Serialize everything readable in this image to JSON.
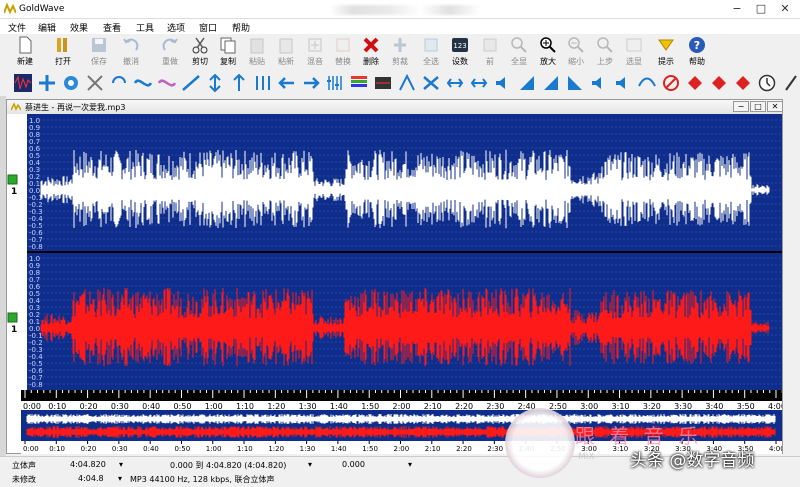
{
  "window": {
    "title": "GoldWave",
    "controls": [
      "−",
      "□",
      "✕"
    ]
  },
  "menu": [
    "文件",
    "编辑",
    "效果",
    "查看",
    "工具",
    "选项",
    "窗口",
    "帮助"
  ],
  "toolbar": [
    {
      "label": "新建",
      "icon": "new-file-icon",
      "enabled": true
    },
    {
      "label": "打开",
      "icon": "open-folder-icon",
      "enabled": true
    },
    {
      "label": "保存",
      "icon": "save-icon",
      "enabled": false
    },
    {
      "label": "撤消",
      "icon": "undo-icon",
      "enabled": false
    },
    {
      "label": "重做",
      "icon": "redo-icon",
      "enabled": false
    },
    {
      "label": "剪切",
      "icon": "scissors-icon",
      "enabled": true
    },
    {
      "label": "复制",
      "icon": "copy-icon",
      "enabled": true
    },
    {
      "label": "粘贴",
      "icon": "paste-icon",
      "enabled": false
    },
    {
      "label": "粘新",
      "icon": "paste-new-icon",
      "enabled": false
    },
    {
      "label": "混音",
      "icon": "mix-icon",
      "enabled": false
    },
    {
      "label": "替换",
      "icon": "replace-icon",
      "enabled": false
    },
    {
      "label": "删除",
      "icon": "delete-icon",
      "enabled": true
    },
    {
      "label": "剪裁",
      "icon": "trim-icon",
      "enabled": false
    },
    {
      "label": "全选",
      "icon": "select-all-icon",
      "enabled": false
    },
    {
      "label": "设数",
      "icon": "set-marker-icon",
      "enabled": true
    },
    {
      "label": "前",
      "icon": "previous-icon",
      "enabled": false
    },
    {
      "label": "全显",
      "icon": "zoom-all-icon",
      "enabled": false
    },
    {
      "label": "放大",
      "icon": "zoom-in-icon",
      "enabled": true
    },
    {
      "label": "缩小",
      "icon": "zoom-out-icon",
      "enabled": false
    },
    {
      "label": "上步",
      "icon": "zoom-previous-icon",
      "enabled": false
    },
    {
      "label": "选显",
      "icon": "zoom-selection-icon",
      "enabled": false
    },
    {
      "label": "提示",
      "icon": "cue-icon",
      "enabled": true
    },
    {
      "label": "帮助",
      "icon": "help-icon",
      "enabled": true
    }
  ],
  "document": {
    "title": "蔡进生 - 再说一次爱我.mp3",
    "controls": [
      "−",
      "□",
      "✕"
    ]
  },
  "amplitude_labels": [
    "1.0",
    "0.9",
    "0.8",
    "0.7",
    "0.6",
    "0.5",
    "0.4",
    "0.3",
    "0.2",
    "0.1",
    "0.0",
    "-0.1",
    "-0.2",
    "-0.3",
    "-0.4",
    "-0.5",
    "-0.6",
    "-0.7",
    "-0.8"
  ],
  "channel_labels": [
    "1",
    "1"
  ],
  "time_labels": [
    "0:00",
    "0:10",
    "0:20",
    "0:30",
    "0:40",
    "0:50",
    "1:00",
    "1:10",
    "1:20",
    "1:30",
    "1:40",
    "1:50",
    "2:00",
    "2:10",
    "2:20",
    "2:30",
    "2:40",
    "2:50",
    "3:00",
    "3:10",
    "3:20",
    "3:30",
    "3:40",
    "3:50",
    "4:00"
  ],
  "colors": {
    "wave_bg": "#0f2d8a",
    "left_channel": "#ffffff",
    "right_channel": "#ff1a1a",
    "grid": "#3a5fc8"
  },
  "status": {
    "channels": "立体声",
    "duration": "4:04.820",
    "selection": "0.000 到 4:04.820 (4:04.820)",
    "position": "0.000",
    "modified": "未修改",
    "length": "4:04.8",
    "format": "MP3 44100 Hz, 128 kbps, 联合立体声"
  },
  "watermark": {
    "text": "头条 @数字音频",
    "logo_text": "跟 着 音 乐",
    "sub": "MIX"
  }
}
